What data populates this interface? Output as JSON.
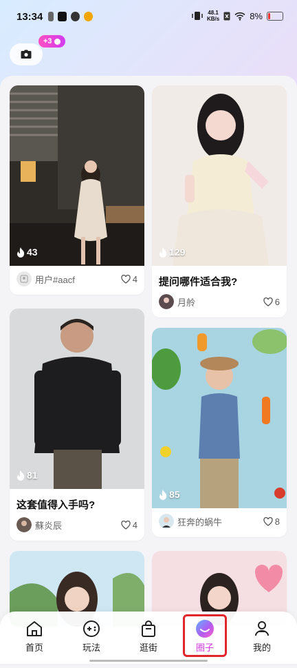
{
  "status_bar": {
    "time": "13:34",
    "net_speed_top": "48.1",
    "net_speed_bottom": "KB/s",
    "battery": "8%"
  },
  "header": {
    "camera_icon": "camera-icon",
    "badge_text": "+3"
  },
  "feed": {
    "cards": [
      {
        "heat": "43",
        "title": "",
        "user": "用户#aacf",
        "likes": "4"
      },
      {
        "heat": "129",
        "title": "提问哪件适合我?",
        "user": "月舲",
        "likes": "6"
      },
      {
        "heat": "81",
        "title": "这套值得入手吗?",
        "user": "蘇炎辰",
        "likes": "4"
      },
      {
        "heat": "85",
        "title": "",
        "user": "狂奔的蜗牛",
        "likes": "8"
      }
    ]
  },
  "nav": {
    "items": [
      {
        "label": "首页",
        "icon": "home-icon"
      },
      {
        "label": "玩法",
        "icon": "gamepad-icon"
      },
      {
        "label": "逛街",
        "icon": "shopping-bag-icon"
      },
      {
        "label": "圈子",
        "icon": "circle-icon",
        "active": true
      },
      {
        "label": "我的",
        "icon": "profile-icon"
      }
    ]
  },
  "colors": {
    "accent": "#d23adf",
    "badge": "#ff4fc1",
    "highlight": "#e0262a"
  }
}
